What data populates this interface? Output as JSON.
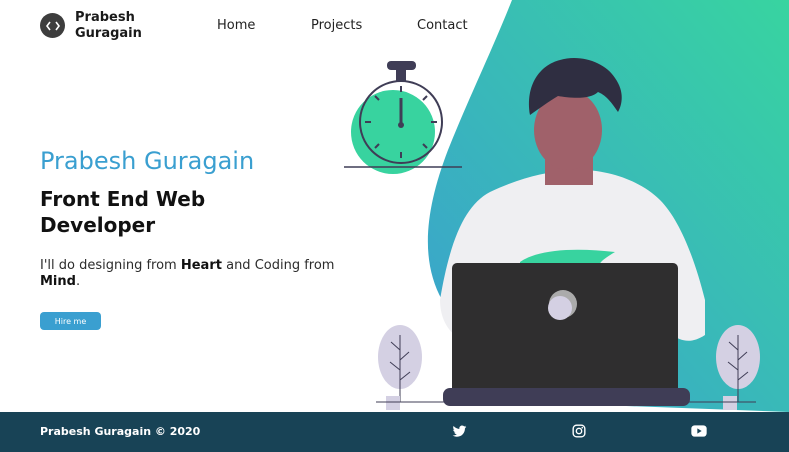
{
  "header": {
    "logo_icon": "code-icon",
    "brand_line1": "Prabesh",
    "brand_line2": "Guragain",
    "nav": [
      {
        "label": "Home"
      },
      {
        "label": "Projects"
      },
      {
        "label": "Contact"
      }
    ]
  },
  "hero": {
    "name": "Prabesh Guragain",
    "role": "Front End Web Developer",
    "tagline_part1": "I'll do designing from ",
    "tagline_bold1": "Heart",
    "tagline_part2": " and Coding from ",
    "tagline_bold2": "Mind",
    "tagline_end": ".",
    "cta_label": "Hire me"
  },
  "footer": {
    "copyright": "Prabesh Guragain © 2020",
    "social": [
      {
        "icon": "twitter-icon"
      },
      {
        "icon": "instagram-icon"
      },
      {
        "icon": "youtube-icon"
      }
    ]
  },
  "colors": {
    "accent": "#3a9fd0",
    "gradient_start": "#3a9fd0",
    "gradient_end": "#38d4a0",
    "footer_bg": "#184356",
    "timer_face": "#38d39f",
    "laptop": "#2f2e2f"
  }
}
